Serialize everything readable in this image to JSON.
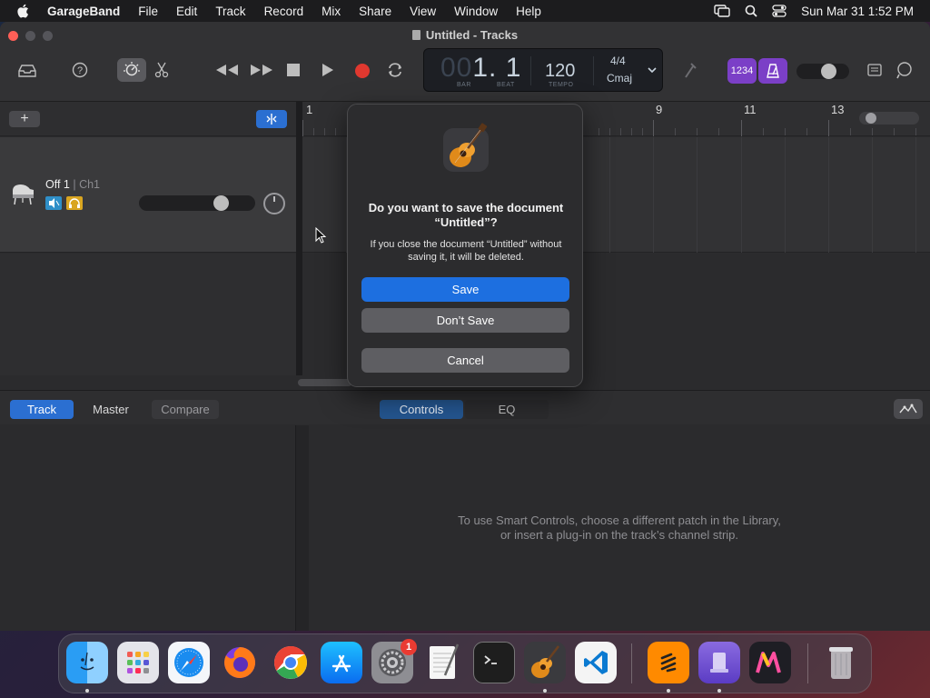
{
  "menubar": {
    "app_name": "GarageBand",
    "items": [
      "File",
      "Edit",
      "Track",
      "Record",
      "Mix",
      "Share",
      "View",
      "Window",
      "Help"
    ],
    "datetime": "Sun Mar 31  1:52 PM"
  },
  "window": {
    "title": "Untitled - Tracks"
  },
  "lcd": {
    "bar_dim": "00",
    "bar_beat": "1. 1",
    "bar_label": "BAR",
    "beat_label": "BEAT",
    "tempo": "120",
    "tempo_label": "TEMPO",
    "time_signature": "4/4",
    "key": "Cmaj",
    "count_in_label": "1234"
  },
  "track": {
    "name": "Off 1",
    "channel": "| Ch1"
  },
  "ruler": {
    "marks": [
      "1",
      "9",
      "11",
      "13"
    ]
  },
  "dialog": {
    "title": "Do you want to save the document “Untitled”?",
    "message": "If you close the document “Untitled” without saving it, it will be deleted.",
    "save_label": "Save",
    "dont_save_label": "Don’t Save",
    "cancel_label": "Cancel"
  },
  "editor": {
    "tabs_left": [
      "Track",
      "Master",
      "Compare"
    ],
    "tabs_center": [
      "Controls",
      "EQ"
    ],
    "message_line1": "To use Smart Controls, choose a different patch in the Library,",
    "message_line2": "or insert a plug-in on the track’s channel strip."
  },
  "dock": {
    "apps": [
      "Finder",
      "Launchpad",
      "Safari",
      "Firefox",
      "Chrome",
      "App Store",
      "System Settings",
      "TextEdit",
      "Terminal",
      "GarageBand",
      "Visual Studio Code",
      "Tableplus",
      "Simulator",
      "Monodraw",
      "Trash"
    ],
    "settings_badge": "1"
  },
  "colors": {
    "accent_blue": "#1d6fe0",
    "record_red": "#e0382f",
    "purple": "#7b3fc7"
  }
}
